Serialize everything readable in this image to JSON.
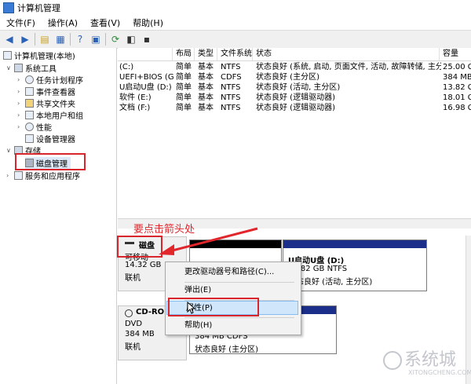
{
  "window": {
    "title": "计算机管理"
  },
  "menu": [
    "文件(F)",
    "操作(A)",
    "查看(V)",
    "帮助(H)"
  ],
  "tree": [
    {
      "label": "计算机管理(本地)",
      "level": 0
    },
    {
      "label": "系统工具",
      "level": 1
    },
    {
      "label": "任务计划程序",
      "level": 2
    },
    {
      "label": "事件查看器",
      "level": 2
    },
    {
      "label": "共享文件夹",
      "level": 2
    },
    {
      "label": "本地用户和组",
      "level": 2
    },
    {
      "label": "性能",
      "level": 2
    },
    {
      "label": "设备管理器",
      "level": 2
    },
    {
      "label": "存储",
      "level": 1
    },
    {
      "label": "磁盘管理",
      "level": 2
    },
    {
      "label": "服务和应用程序",
      "level": 1
    }
  ],
  "volumes": {
    "columns": [
      "",
      "布局",
      "类型",
      "文件系统",
      "状态",
      "容量"
    ],
    "rows": [
      [
        "(C:)",
        "简单",
        "基本",
        "NTFS",
        "状态良好 (系统, 启动, 页面文件, 活动, 故障转储, 主分区)",
        "25.00 G"
      ],
      [
        "UEFI+BIOS (G:)",
        "简单",
        "基本",
        "CDFS",
        "状态良好 (主分区)",
        "384 MB"
      ],
      [
        "U启动U盘 (D:)",
        "简单",
        "基本",
        "NTFS",
        "状态良好 (活动, 主分区)",
        "13.82 G"
      ],
      [
        "软件 (E:)",
        "简单",
        "基本",
        "NTFS",
        "状态良好 (逻辑驱动器)",
        "18.01 G"
      ],
      [
        "文档 (F:)",
        "简单",
        "基本",
        "NTFS",
        "状态良好 (逻辑驱动器)",
        "16.98 G"
      ]
    ]
  },
  "disks": {
    "disk1": {
      "name": "磁盘",
      "type": "可移动",
      "size": "14.32 GB",
      "status": "联机"
    },
    "disk1_part": {
      "name": "U启动U盘  (D:)",
      "size_fs": "13.82 GB NTFS",
      "status": "状态良好 (活动, 主分区)"
    },
    "cdrom": {
      "name": "CD-ROM",
      "type": "DVD",
      "size": "384 MB",
      "status": "联机"
    },
    "cdrom_part": {
      "size_fs": "384 MB CDFS",
      "status": "状态良好 (主分区)"
    }
  },
  "context_menu": {
    "items": [
      "更改驱动器号和路径(C)...",
      "弹出(E)",
      "属性(P)",
      "帮助(H)"
    ],
    "selected": 2
  },
  "annotation": "要点击箭头处",
  "watermark": {
    "main": "系统城",
    "sub": "XITONGCHENG.COM"
  },
  "colors": {
    "highlight": "#d9262c",
    "selection": "#cfe6fb",
    "volume_bar": "#1b2f8a"
  }
}
